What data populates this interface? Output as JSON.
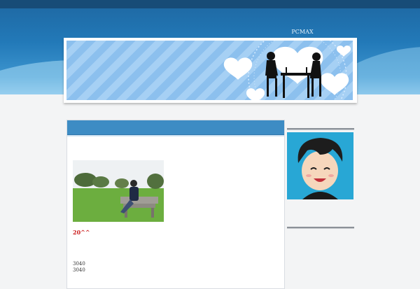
{
  "header": {
    "site_title": "PCMAX"
  },
  "post": {
    "title": "20^^",
    "lines": [
      "3040",
      "3040"
    ]
  },
  "icons": {
    "banner": "couple-dinner-silhouette",
    "photo": "man-on-bench-photo",
    "avatar": "smiling-boy-avatar"
  },
  "colors": {
    "header_blue": "#2279b8",
    "content_bar": "#3d8cc4",
    "post_title": "#cc1f1f",
    "avatar_bg": "#28a7d5"
  }
}
